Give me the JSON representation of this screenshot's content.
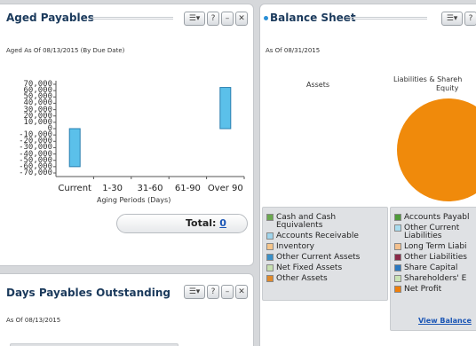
{
  "aged_payables": {
    "title": "Aged Payables",
    "subtitle": "Aged As Of 08/13/2015 (By Due Date)",
    "controls": {
      "menu": "☰▾",
      "help": "?",
      "minimize": "–",
      "close": "✕"
    },
    "total_label": "Total: ",
    "total_value": "0"
  },
  "chart_data": {
    "type": "bar",
    "categories": [
      "Current",
      "1-30",
      "31-60",
      "61-90",
      "Over 90"
    ],
    "values": [
      -60000,
      0,
      0,
      0,
      65000
    ],
    "ylim": [
      -70000,
      70000
    ],
    "y_ticks": [
      "70,000",
      "60,000",
      "50,000",
      "40,000",
      "30,000",
      "20,000",
      "10,000",
      "0",
      "-10,000",
      "-20,000",
      "-30,000",
      "-40,000",
      "-50,000",
      "-60,000",
      "-70,000"
    ],
    "y_tick_values": [
      70000,
      60000,
      50000,
      40000,
      30000,
      20000,
      10000,
      0,
      -10000,
      -20000,
      -30000,
      -40000,
      -50000,
      -60000,
      -70000
    ],
    "xlabel": "Aging Periods (Days)",
    "ylabel": "",
    "bar_color": "#5bc0ea",
    "bar_border": "#2a7fb0"
  },
  "balance_sheet": {
    "title": "Balance Sheet",
    "subtitle": "As Of 08/31/2015",
    "assets_label": "Assets",
    "liabilities_label": "Liabilities & Shareh",
    "liabilities_label2": "Equity",
    "pie_color": "#f08a0b",
    "assets_legend": [
      {
        "label": "Cash and Cash",
        "label2": "Equivalents",
        "color": "#6aa84f"
      },
      {
        "label": "Accounts Receivable",
        "color": "#9fd4ec"
      },
      {
        "label": "Inventory",
        "color": "#f5c58a"
      },
      {
        "label": "Other Current Assets",
        "color": "#3a90c8"
      },
      {
        "label": "Net Fixed Assets",
        "color": "#c7e0b0"
      },
      {
        "label": "Other Assets",
        "color": "#e08a2c"
      }
    ],
    "liabilities_legend": [
      {
        "label": "Accounts Payabl",
        "color": "#4f9a3a"
      },
      {
        "label": "Other Current",
        "label2": "Liabilities",
        "color": "#a9dcef"
      },
      {
        "label": "Long Term Liabi",
        "color": "#f3c08d"
      },
      {
        "label": "Other Liabilities",
        "color": "#8a2a4a"
      },
      {
        "label": "Share Capital",
        "color": "#2a78c0"
      },
      {
        "label": "Shareholders' E",
        "color": "#c9e2b4"
      },
      {
        "label": "Net Profit",
        "color": "#ee7f0c"
      }
    ],
    "view_link": "View Balance",
    "controls": {
      "menu": "☰▾",
      "help": "?"
    }
  },
  "days_payables": {
    "title": "Days Payables Outstanding",
    "subtitle": "As Of 08/13/2015",
    "controls": {
      "menu": "☰▾",
      "help": "?",
      "minimize": "–",
      "close": "✕"
    }
  }
}
